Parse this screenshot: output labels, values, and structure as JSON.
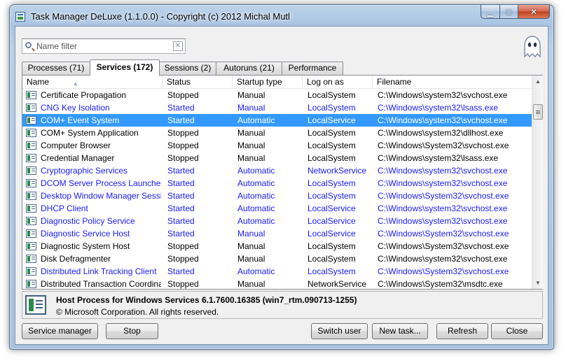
{
  "window": {
    "title": "Task Manager DeLuxe (1.1.0.0) - Copyright (c) 2012 Michal Mutl"
  },
  "filter": {
    "placeholder": "Name filter",
    "clear_glyph": "✕"
  },
  "tabs": [
    {
      "label": "Processes (71)",
      "active": false
    },
    {
      "label": "Services (172)",
      "active": true
    },
    {
      "label": "Sessions (2)",
      "active": false
    },
    {
      "label": "Autoruns (21)",
      "active": false
    },
    {
      "label": "Performance",
      "active": false
    }
  ],
  "table": {
    "columns": [
      "Name",
      "Status",
      "Startup type",
      "Log on as",
      "Filename"
    ],
    "sort_indicator": "▲",
    "rows": [
      {
        "name": "Certificate Propagation",
        "status": "Stopped",
        "startup": "Manual",
        "logon": "LocalSystem",
        "file": "C:\\Windows\\system32\\svchost.exe"
      },
      {
        "name": "CNG Key Isolation",
        "status": "Started",
        "startup": "Manual",
        "logon": "LocalSystem",
        "file": "C:\\Windows\\system32\\lsass.exe"
      },
      {
        "name": "COM+ Event System",
        "status": "Started",
        "startup": "Automatic",
        "logon": "LocalService",
        "file": "C:\\Windows\\system32\\svchost.exe",
        "selected": true
      },
      {
        "name": "COM+ System Application",
        "status": "Stopped",
        "startup": "Manual",
        "logon": "LocalSystem",
        "file": "C:\\Windows\\system32\\dllhost.exe"
      },
      {
        "name": "Computer Browser",
        "status": "Stopped",
        "startup": "Manual",
        "logon": "LocalSystem",
        "file": "C:\\Windows\\System32\\svchost.exe"
      },
      {
        "name": "Credential Manager",
        "status": "Stopped",
        "startup": "Manual",
        "logon": "LocalSystem",
        "file": "C:\\Windows\\system32\\lsass.exe"
      },
      {
        "name": "Cryptographic Services",
        "status": "Started",
        "startup": "Automatic",
        "logon": "NetworkService",
        "file": "C:\\Windows\\system32\\svchost.exe"
      },
      {
        "name": "DCOM Server Process Launcher",
        "status": "Started",
        "startup": "Automatic",
        "logon": "LocalSystem",
        "file": "C:\\Windows\\system32\\svchost.exe"
      },
      {
        "name": "Desktop Window Manager Sessi...",
        "status": "Started",
        "startup": "Automatic",
        "logon": "LocalSystem",
        "file": "C:\\Windows\\System32\\svchost.exe"
      },
      {
        "name": "DHCP Client",
        "status": "Started",
        "startup": "Automatic",
        "logon": "LocalService",
        "file": "C:\\Windows\\system32\\svchost.exe"
      },
      {
        "name": "Diagnostic Policy Service",
        "status": "Started",
        "startup": "Automatic",
        "logon": "LocalService",
        "file": "C:\\Windows\\system32\\svchost.exe"
      },
      {
        "name": "Diagnostic Service Host",
        "status": "Started",
        "startup": "Manual",
        "logon": "LocalService",
        "file": "C:\\Windows\\System32\\svchost.exe"
      },
      {
        "name": "Diagnostic System Host",
        "status": "Stopped",
        "startup": "Manual",
        "logon": "LocalSystem",
        "file": "C:\\Windows\\System32\\svchost.exe"
      },
      {
        "name": "Disk Defragmenter",
        "status": "Stopped",
        "startup": "Manual",
        "logon": "LocalSystem",
        "file": "C:\\Windows\\system32\\svchost.exe"
      },
      {
        "name": "Distributed Link Tracking Client",
        "status": "Started",
        "startup": "Automatic",
        "logon": "LocalSystem",
        "file": "C:\\Windows\\System32\\svchost.exe"
      },
      {
        "name": "Distributed Transaction Coordina...",
        "status": "Stopped",
        "startup": "Manual",
        "logon": "NetworkService",
        "file": "C:\\Windows\\System32\\msdtc.exe"
      }
    ]
  },
  "info": {
    "title": "Host Process for Windows Services 6.1.7600.16385 (win7_rtm.090713-1255)",
    "copyright": "© Microsoft Corporation. All rights reserved."
  },
  "buttons": {
    "service_manager": "Service manager",
    "stop": "Stop",
    "switch_user": "Switch user",
    "new_task": "New task...",
    "refresh": "Refresh",
    "close": "Close"
  },
  "icons": {
    "app": "task-manager-icon",
    "mascot": "ghost-icon",
    "filter": "search-icon",
    "service": "service-icon"
  },
  "colors": {
    "running_text": "#1a1aff",
    "stopped_text": "#000000",
    "selection": "#3399ff"
  }
}
